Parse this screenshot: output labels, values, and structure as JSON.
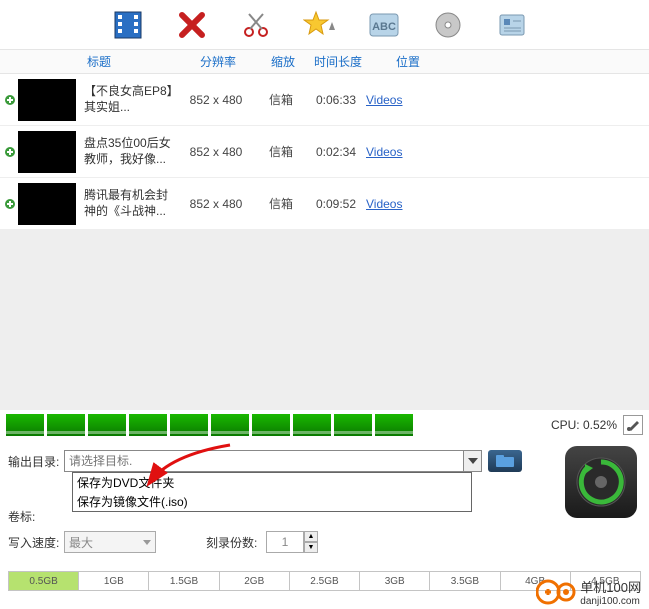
{
  "headers": {
    "title": "标题",
    "resolution": "分辨率",
    "scale": "缩放",
    "duration": "时间长度",
    "location": "位置"
  },
  "items": [
    {
      "title": "【不良女高EP8】其实姐...",
      "resolution": "852 x 480",
      "scale": "信箱",
      "duration": "0:06:33",
      "location": "Videos"
    },
    {
      "title": "盘点35位00后女教师，我好像...",
      "resolution": "852 x 480",
      "scale": "信箱",
      "duration": "0:02:34",
      "location": "Videos"
    },
    {
      "title": "腾讯最有机会封神的《斗战神...",
      "resolution": "852 x 480",
      "scale": "信箱",
      "duration": "0:09:52",
      "location": "Videos"
    }
  ],
  "cpu": {
    "label": "CPU: 0.52%"
  },
  "settings": {
    "outdir_label": "输出目录:",
    "outdir_placeholder": "请选择目标.",
    "volume_label": "卷标:",
    "writespeed_label": "写入速度:",
    "writespeed_value": "最大",
    "burncount_label": "刻录份数:",
    "burncount_value": "1",
    "dropdown": [
      "保存为DVD文件夹",
      "保存为镜像文件(.iso)"
    ]
  },
  "sizebar": [
    "0.5GB",
    "1GB",
    "1.5GB",
    "2GB",
    "2.5GB",
    "3GB",
    "3.5GB",
    "4GB",
    "4.5GB"
  ],
  "watermark": {
    "brand": "单机100网",
    "url": "danji100.com"
  }
}
